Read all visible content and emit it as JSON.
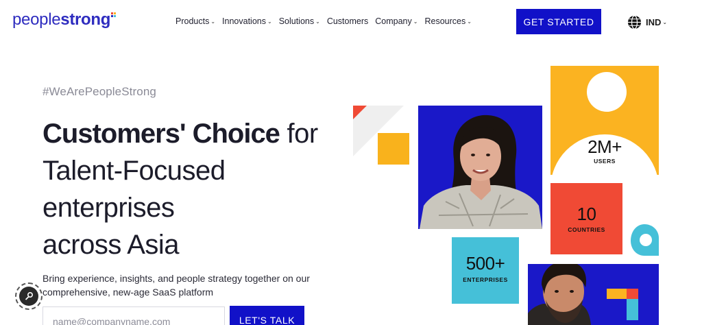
{
  "header": {
    "logo_part1": "people",
    "logo_part2": "strong",
    "nav": [
      {
        "label": "Products",
        "has_dropdown": true
      },
      {
        "label": "Innovations",
        "has_dropdown": true
      },
      {
        "label": "Solutions",
        "has_dropdown": true
      },
      {
        "label": "Customers",
        "has_dropdown": false
      },
      {
        "label": "Company",
        "has_dropdown": true
      },
      {
        "label": "Resources",
        "has_dropdown": true
      }
    ],
    "cta_label": "GET STARTED",
    "region_label": "IND",
    "region_icon": "globe-icon"
  },
  "hero": {
    "hashtag": "#WeArePeopleStrong",
    "headline_bold": "Customers' Choice",
    "headline_rest1": " for",
    "headline_line2": "Talent-Focused",
    "headline_line3": "enterprises",
    "headline_line4": "across Asia",
    "subtext": "Bring experience, insights, and people strategy together on our comprehensive, new-age SaaS platform",
    "email_placeholder": "name@companyname.com",
    "talk_label": "LET'S TALK"
  },
  "stats": {
    "users_value": "2M+",
    "users_label": "USERS",
    "countries_value": "10",
    "countries_label": "COUNTRIES",
    "enterprises_value": "500+",
    "enterprises_label": "ENTERPRISES"
  },
  "colors": {
    "brand_blue": "#1111c8",
    "logo_blue": "#2e2cbf",
    "yellow": "#fbb321",
    "red": "#f04a35",
    "teal": "#45c0d8"
  }
}
